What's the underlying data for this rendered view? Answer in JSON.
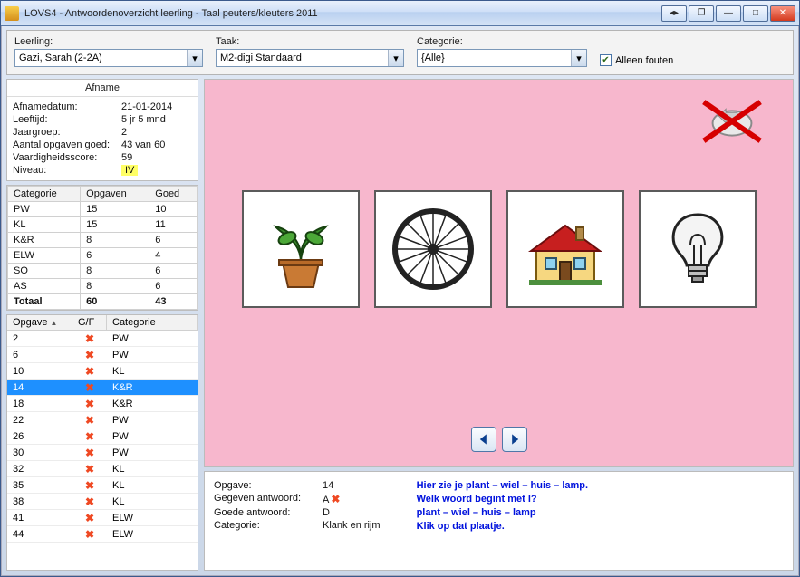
{
  "window": {
    "title": "LOVS4 - Antwoordenoverzicht leerling - Taal peuters/kleuters 2011"
  },
  "filters": {
    "leerling": {
      "label": "Leerling:",
      "value": "Gazi, Sarah (2-2A)"
    },
    "taak": {
      "label": "Taak:",
      "value": "M2-digi Standaard"
    },
    "categorie": {
      "label": "Categorie:",
      "value": "{Alle}"
    },
    "alleen_fouten": {
      "label": "Alleen fouten",
      "checked": true
    }
  },
  "afname": {
    "header": "Afname",
    "rows": {
      "afnamedatum": {
        "k": "Afnamedatum:",
        "v": "21-01-2014"
      },
      "leeftijd": {
        "k": "Leeftijd:",
        "v": "5 jr 5 mnd"
      },
      "jaargroep": {
        "k": "Jaargroep:",
        "v": "2"
      },
      "aantal_goed": {
        "k": "Aantal opgaven goed:",
        "v": "43 van 60"
      },
      "vaardigheidsscore": {
        "k": "Vaardigheidsscore:",
        "v": "59"
      },
      "niveau": {
        "k": "Niveau:",
        "v": "IV"
      }
    }
  },
  "cat_table": {
    "headers": {
      "categorie": "Categorie",
      "opgaven": "Opgaven",
      "goed": "Goed"
    },
    "rows": [
      {
        "cat": "PW",
        "opg": "15",
        "goed": "10"
      },
      {
        "cat": "KL",
        "opg": "15",
        "goed": "11"
      },
      {
        "cat": "K&R",
        "opg": "8",
        "goed": "6"
      },
      {
        "cat": "ELW",
        "opg": "6",
        "goed": "4"
      },
      {
        "cat": "SO",
        "opg": "8",
        "goed": "6"
      },
      {
        "cat": "AS",
        "opg": "8",
        "goed": "6"
      }
    ],
    "totaal": {
      "cat": "Totaal",
      "opg": "60",
      "goed": "43"
    }
  },
  "opg_table": {
    "headers": {
      "opgave": "Opgave",
      "gf": "G/F",
      "categorie": "Categorie"
    },
    "selected": 3,
    "rows": [
      {
        "n": "2",
        "cat": "PW"
      },
      {
        "n": "6",
        "cat": "PW"
      },
      {
        "n": "10",
        "cat": "KL"
      },
      {
        "n": "14",
        "cat": "K&R"
      },
      {
        "n": "18",
        "cat": "K&R"
      },
      {
        "n": "22",
        "cat": "PW"
      },
      {
        "n": "26",
        "cat": "PW"
      },
      {
        "n": "30",
        "cat": "PW"
      },
      {
        "n": "32",
        "cat": "KL"
      },
      {
        "n": "35",
        "cat": "KL"
      },
      {
        "n": "38",
        "cat": "KL"
      },
      {
        "n": "41",
        "cat": "ELW"
      },
      {
        "n": "44",
        "cat": "ELW"
      }
    ]
  },
  "detail": {
    "opgave": {
      "k": "Opgave:",
      "v": "14"
    },
    "gegeven": {
      "k": "Gegeven antwoord:",
      "v": "A"
    },
    "goede": {
      "k": "Goede antwoord:",
      "v": "D"
    },
    "categorie": {
      "k": "Categorie:",
      "v": "Klank en rijm"
    },
    "prompt": {
      "l1": "Hier zie je plant – wiel – huis – lamp.",
      "l2": "Welk woord begint met l?",
      "l3": "plant – wiel – huis – lamp",
      "l4": "Klik op dat plaatje."
    }
  },
  "cards": [
    "plant",
    "wiel",
    "huis",
    "lamp"
  ]
}
